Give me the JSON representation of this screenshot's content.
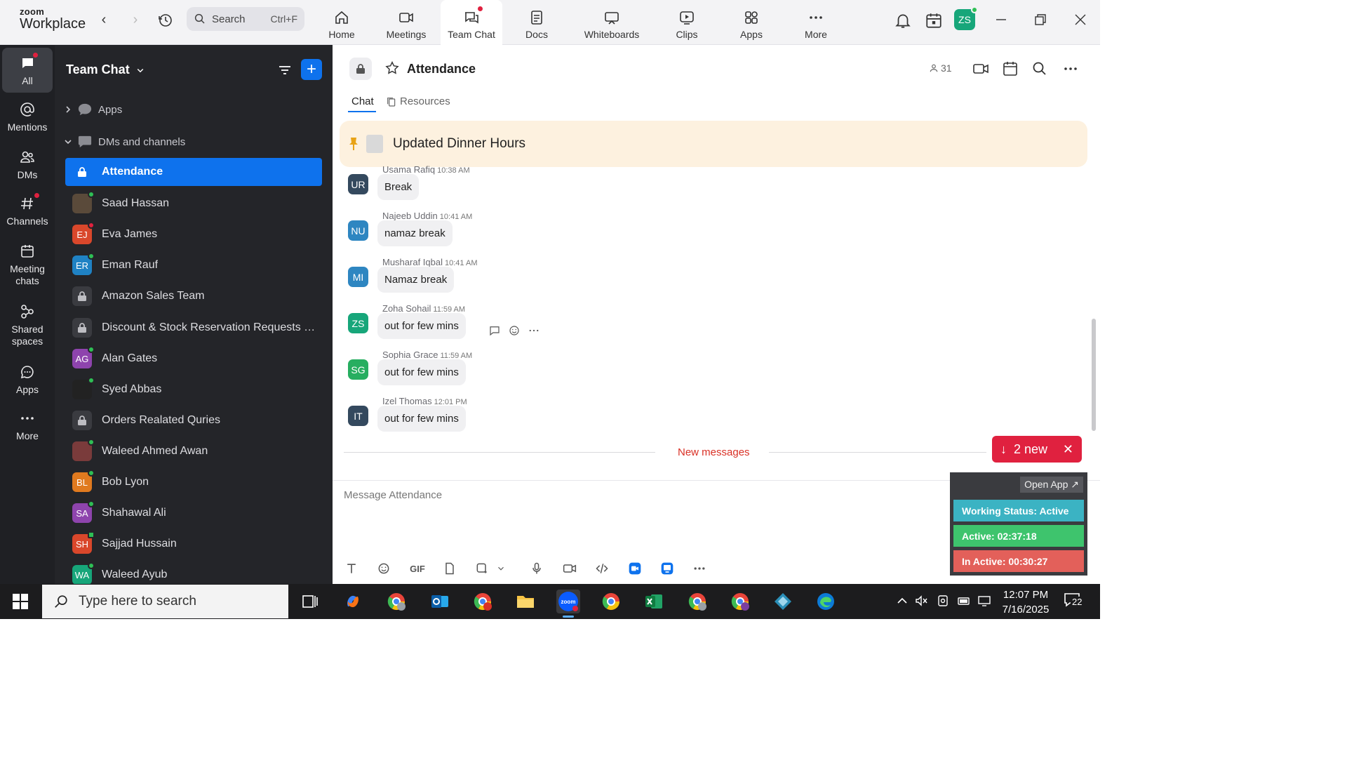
{
  "app": {
    "logo_top": "zoom",
    "logo_bottom": "Workplace",
    "search_label": "Search",
    "search_shortcut": "Ctrl+F",
    "tabs": [
      {
        "label": "Home",
        "icon": "home-icon"
      },
      {
        "label": "Meetings",
        "icon": "video-camera-icon"
      },
      {
        "label": "Team Chat",
        "icon": "chat-bubbles-icon",
        "active": true
      },
      {
        "label": "Docs",
        "icon": "document-icon"
      },
      {
        "label": "Whiteboards",
        "icon": "whiteboard-icon"
      },
      {
        "label": "Clips",
        "icon": "clips-icon"
      },
      {
        "label": "Apps",
        "icon": "apps-icon"
      },
      {
        "label": "More",
        "icon": "more-dots-icon"
      }
    ],
    "user_initials": "ZS",
    "accent": "#0e72ed"
  },
  "rail": [
    {
      "label": "All",
      "icon": "chat-icon"
    },
    {
      "label": "Mentions",
      "icon": "at-icon"
    },
    {
      "label": "DMs",
      "icon": "people-icon"
    },
    {
      "label": "Channels",
      "icon": "hash-icon"
    },
    {
      "label": "Meeting chats",
      "icon": "calendar-icon"
    },
    {
      "label": "Shared spaces",
      "icon": "shared-spaces-icon"
    },
    {
      "label": "Apps",
      "icon": "apps-chat-icon"
    },
    {
      "label": "More",
      "icon": "more-dots-icon"
    }
  ],
  "sidebar": {
    "title": "Team Chat",
    "sections": {
      "apps": "Apps",
      "dms": "DMs and channels"
    },
    "items": [
      {
        "name": "Attendance",
        "type": "lock",
        "active": true
      },
      {
        "name": "Saad Hassan",
        "type": "photo",
        "color": "#5a4a3a",
        "status": "online"
      },
      {
        "name": "Eva James",
        "initials": "EJ",
        "color": "#d9472b",
        "status": "phone"
      },
      {
        "name": "Eman Rauf",
        "initials": "ER",
        "color": "#1f82c4",
        "status": "online"
      },
      {
        "name": "Amazon Sales Team",
        "type": "lock"
      },
      {
        "name": "Discount & Stock Reservation Requests O...",
        "type": "lock"
      },
      {
        "name": "Alan Gates",
        "initials": "AG",
        "color": "#8e44ad",
        "status": "online"
      },
      {
        "name": "Syed Abbas",
        "type": "photo",
        "color": "#222222",
        "status": "online"
      },
      {
        "name": "Orders Realated Quries",
        "type": "lock"
      },
      {
        "name": "Waleed Ahmed Awan",
        "type": "photo",
        "color": "#7a3b3b",
        "status": "online"
      },
      {
        "name": "Bob Lyon",
        "initials": "BL",
        "color": "#e07a1f",
        "status": "online"
      },
      {
        "name": "Shahawal Ali",
        "initials": "SA",
        "color": "#8e44ad",
        "status": "online"
      },
      {
        "name": "Sajjad Hussain",
        "initials": "SH",
        "color": "#d9472b",
        "status": "mobile"
      },
      {
        "name": "Waleed Ayub",
        "initials": "WA",
        "color": "#17a67a",
        "status": "online"
      }
    ]
  },
  "channel": {
    "title": "Attendance",
    "member_count": "31",
    "tabs": {
      "chat": "Chat",
      "resources": "Resources"
    },
    "pinned": "Updated Dinner Hours",
    "messages": [
      {
        "sender": "Usama Rafiq",
        "time": "10:38 AM",
        "initials": "UR",
        "color": "#34495e",
        "text": "Break"
      },
      {
        "sender": "Najeeb Uddin",
        "time": "10:41 AM",
        "initials": "NU",
        "color": "#2e86c1",
        "text": "namaz break"
      },
      {
        "sender": "Musharaf Iqbal",
        "time": "10:41 AM",
        "initials": "MI",
        "color": "#2e86c1",
        "text": "Namaz break"
      },
      {
        "sender": "Zoha Sohail",
        "time": "11:59 AM",
        "initials": "ZS",
        "color": "#17a67a",
        "text": "out for few mins"
      },
      {
        "sender": "Sophia Grace",
        "time": "11:59 AM",
        "initials": "SG",
        "color": "#27ae60",
        "text": "out for few mins"
      },
      {
        "sender": "Izel Thomas",
        "time": "12:01 PM",
        "initials": "IT",
        "color": "#34495e",
        "text": "out for few mins"
      }
    ],
    "new_messages_label": "New messages",
    "new_pill": "2 new",
    "compose_placeholder": "Message Attendance",
    "toolbar_gif": "GIF"
  },
  "widget": {
    "open_app": "Open App ↗",
    "status": "Working Status: Active",
    "active": "Active: 02:37:18",
    "inactive": "In Active: 00:30:27",
    "colors": {
      "status": "#3bb3c3",
      "active": "#3ec46d",
      "inactive": "#e3605a"
    }
  },
  "taskbar": {
    "search_placeholder": "Type here to search",
    "time": "12:07 PM",
    "date": "7/16/2025",
    "notifications": "22"
  }
}
